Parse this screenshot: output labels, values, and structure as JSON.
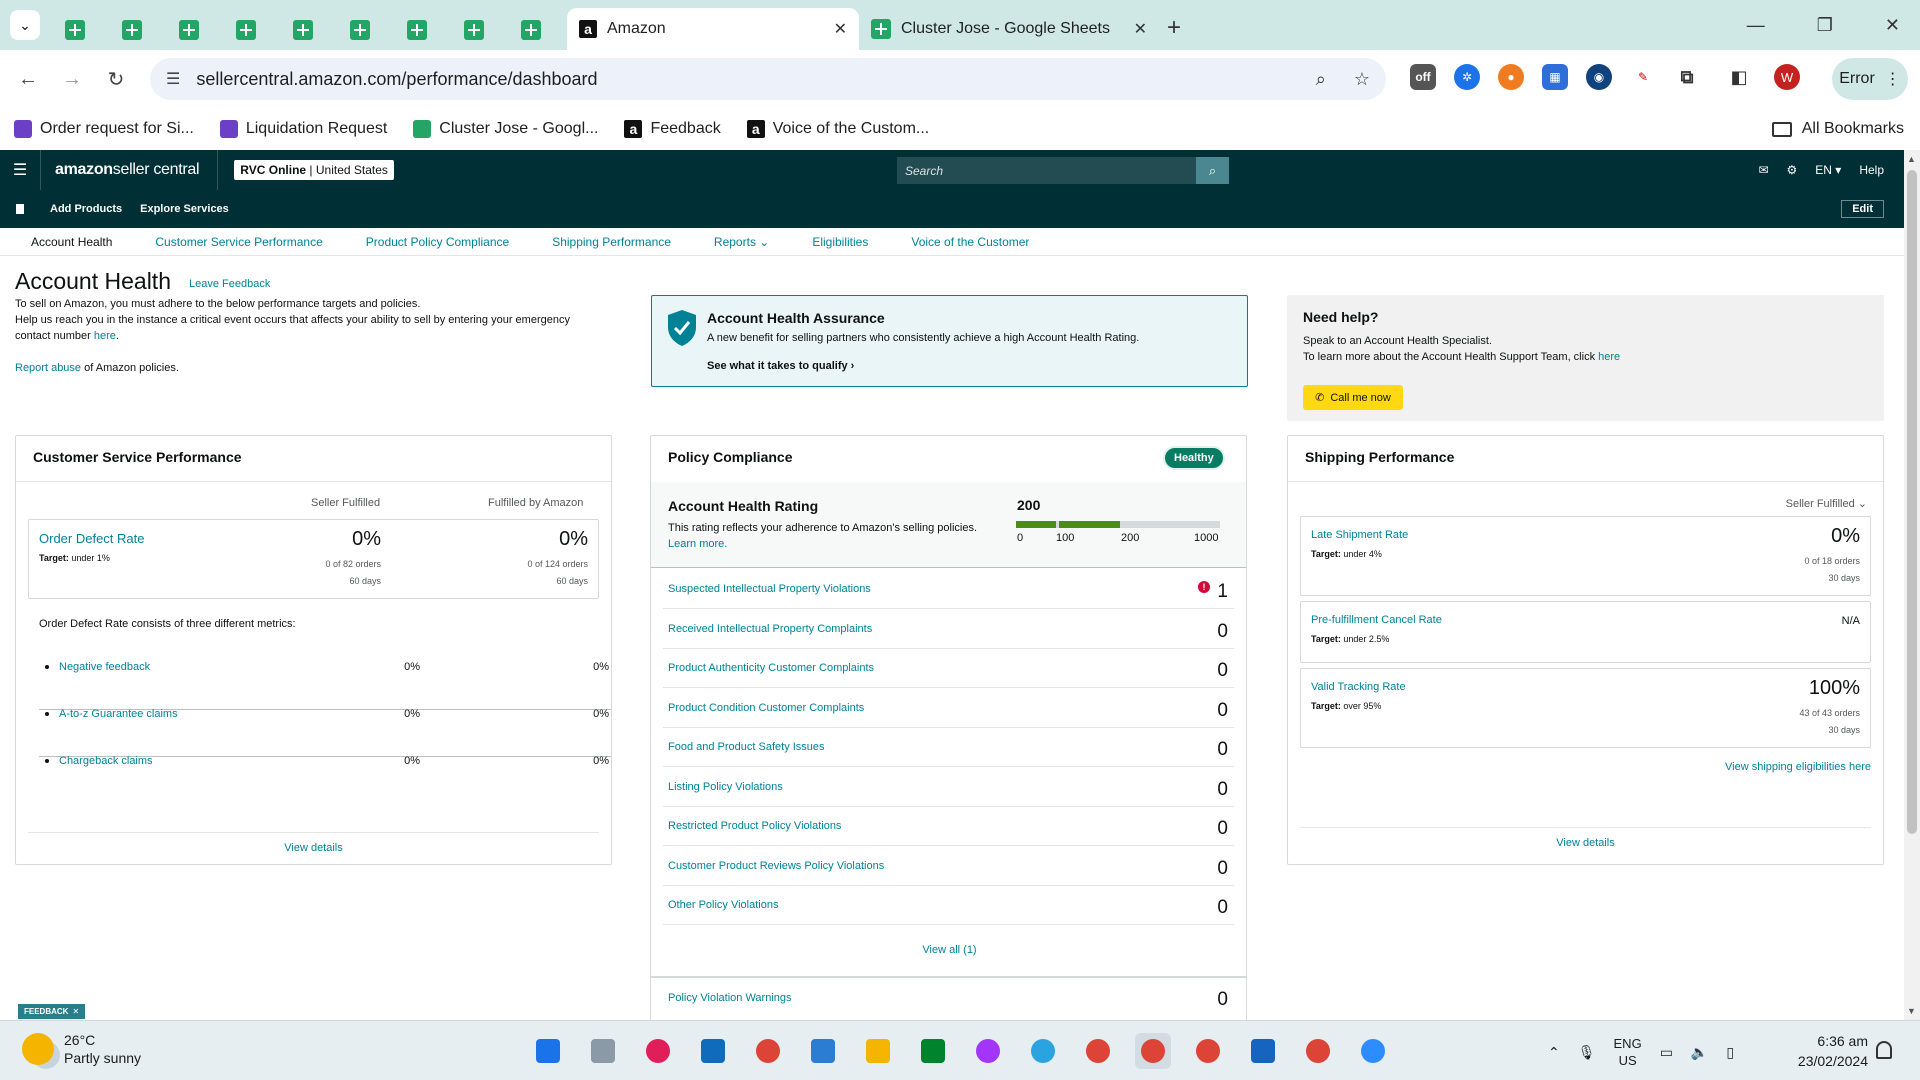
{
  "browser": {
    "pinned_tab_count": 9,
    "tabs": [
      {
        "title": "Amazon",
        "active": true
      },
      {
        "title": "Cluster Jose - Google Sheets",
        "active": false
      }
    ],
    "url": "sellercentral.amazon.com/performance/dashboard",
    "profile_initial": "W",
    "profile_status": "Error",
    "bookmarks": [
      {
        "label": "Order request for Si...",
        "icon": "forms-icon"
      },
      {
        "label": "Liquidation Request",
        "icon": "forms-icon"
      },
      {
        "label": "Cluster Jose - Googl...",
        "icon": "sheets-icon"
      },
      {
        "label": "Feedback",
        "icon": "amazon-icon"
      },
      {
        "label": "Voice of the Custom...",
        "icon": "amazon-icon"
      }
    ],
    "all_bookmarks": "All Bookmarks"
  },
  "header": {
    "logo_bold": "amazon",
    "logo_rest": " seller central",
    "store_name": "RVC Online",
    "store_region": "United States",
    "search_placeholder": "Search",
    "language": "EN",
    "help": "Help",
    "sub_links": [
      "Add Products",
      "Explore Services"
    ],
    "edit": "Edit"
  },
  "perf_tabs": [
    {
      "label": "Account Health",
      "current": true
    },
    {
      "label": "Customer Service Performance"
    },
    {
      "label": "Product Policy Compliance"
    },
    {
      "label": "Shipping Performance"
    },
    {
      "label": "Reports ⌄"
    },
    {
      "label": "Eligibilities"
    },
    {
      "label": "Voice of the Customer"
    }
  ],
  "account_health": {
    "title": "Account Health",
    "leave_feedback": "Leave Feedback",
    "line1": "To sell on Amazon, you must adhere to the below performance targets and policies.",
    "line2": "Help us reach you in the instance a critical event occurs that affects your ability to sell by entering your emergency contact number ",
    "here": "here",
    "report_abuse": "Report abuse",
    "report_rest": " of Amazon policies."
  },
  "assurance": {
    "title": "Account Health Assurance",
    "desc": "A new benefit for selling partners who consistently achieve a high Account Health Rating.",
    "link": "See what it takes to qualify"
  },
  "need_help": {
    "title": "Need help?",
    "line1": "Speak to an Account Health Specialist.",
    "line2": "To learn more about the Account Health Support Team, click ",
    "here": "here",
    "call": "Call me now"
  },
  "csp": {
    "title": "Customer Service Performance",
    "col1": "Seller Fulfilled",
    "col2": "Fulfilled by Amazon",
    "odr_name": "Order Defect Rate",
    "odr_target": "Target:",
    "odr_target_val": " under 1%",
    "sf_value": "0%",
    "sf_orders": "0 of 82 orders",
    "sf_days": "60 days",
    "fba_value": "0%",
    "fba_orders": "0 of 124 orders",
    "fba_days": "60 days",
    "consists": "Order Defect Rate consists of three different metrics:",
    "metrics": [
      {
        "name": "Negative feedback",
        "sf": "0%",
        "fba": "0%"
      },
      {
        "name": "A-to-z Guarantee claims",
        "sf": "0%",
        "fba": "0%"
      },
      {
        "name": "Chargeback claims",
        "sf": "0%",
        "fba": "0%"
      }
    ],
    "view_details": "View details"
  },
  "policy": {
    "title": "Policy Compliance",
    "status": "Healthy",
    "ahr_title": "Account Health Rating",
    "ahr_desc": "This rating reflects your adherence to Amazon's selling policies. ",
    "learn_more": "Learn more.",
    "score": "200",
    "score_max": 1000,
    "ticks": [
      "0",
      "100",
      "200",
      "1000"
    ],
    "rows": [
      {
        "name": "Suspected Intellectual Property Violations",
        "value": "1",
        "alert": "!"
      },
      {
        "name": "Received Intellectual Property Complaints",
        "value": "0"
      },
      {
        "name": "Product Authenticity Customer Complaints",
        "value": "0"
      },
      {
        "name": "Product Condition Customer Complaints",
        "value": "0"
      },
      {
        "name": "Food and Product Safety Issues",
        "value": "0"
      },
      {
        "name": "Listing Policy Violations",
        "value": "0"
      },
      {
        "name": "Restricted Product Policy Violations",
        "value": "0"
      },
      {
        "name": "Customer Product Reviews Policy Violations",
        "value": "0"
      },
      {
        "name": "Other Policy Violations",
        "value": "0"
      }
    ],
    "view_all": "View all (1)",
    "warnings": "Policy Violation Warnings",
    "warnings_value": "0"
  },
  "shipping": {
    "title": "Shipping Performance",
    "filter": "Seller Fulfilled ⌄",
    "metrics": [
      {
        "name": "Late Shipment Rate",
        "target_val": " under 4%",
        "value": "0%",
        "orders": "0 of 18 orders",
        "days": "30 days"
      },
      {
        "name": "Pre-fulfillment Cancel Rate",
        "target_val": " under 2.5%",
        "value": "N/A"
      },
      {
        "name": "Valid Tracking Rate",
        "target_val": " over 95%",
        "value": "100%",
        "orders": "43 of 43 orders",
        "days": "30 days"
      }
    ],
    "target_label": "Target:",
    "eligibilities": "View shipping eligibilities here",
    "view_details": "View details"
  },
  "feedback_tab": "FEEDBACK",
  "taskbar": {
    "temp": "26°C",
    "weather": "Partly sunny",
    "lang1": "ENG",
    "lang2": "US",
    "time": "6:36 am",
    "date": "23/02/2024"
  },
  "colors": {
    "chrome_tab_bg": "#cfe8e6",
    "sc_header": "#002f36",
    "link": "#008296",
    "healthy": "#067d62",
    "rating_bar": "#4d8c1a",
    "call_button": "#ffd814",
    "alert": "#cc0c39"
  }
}
